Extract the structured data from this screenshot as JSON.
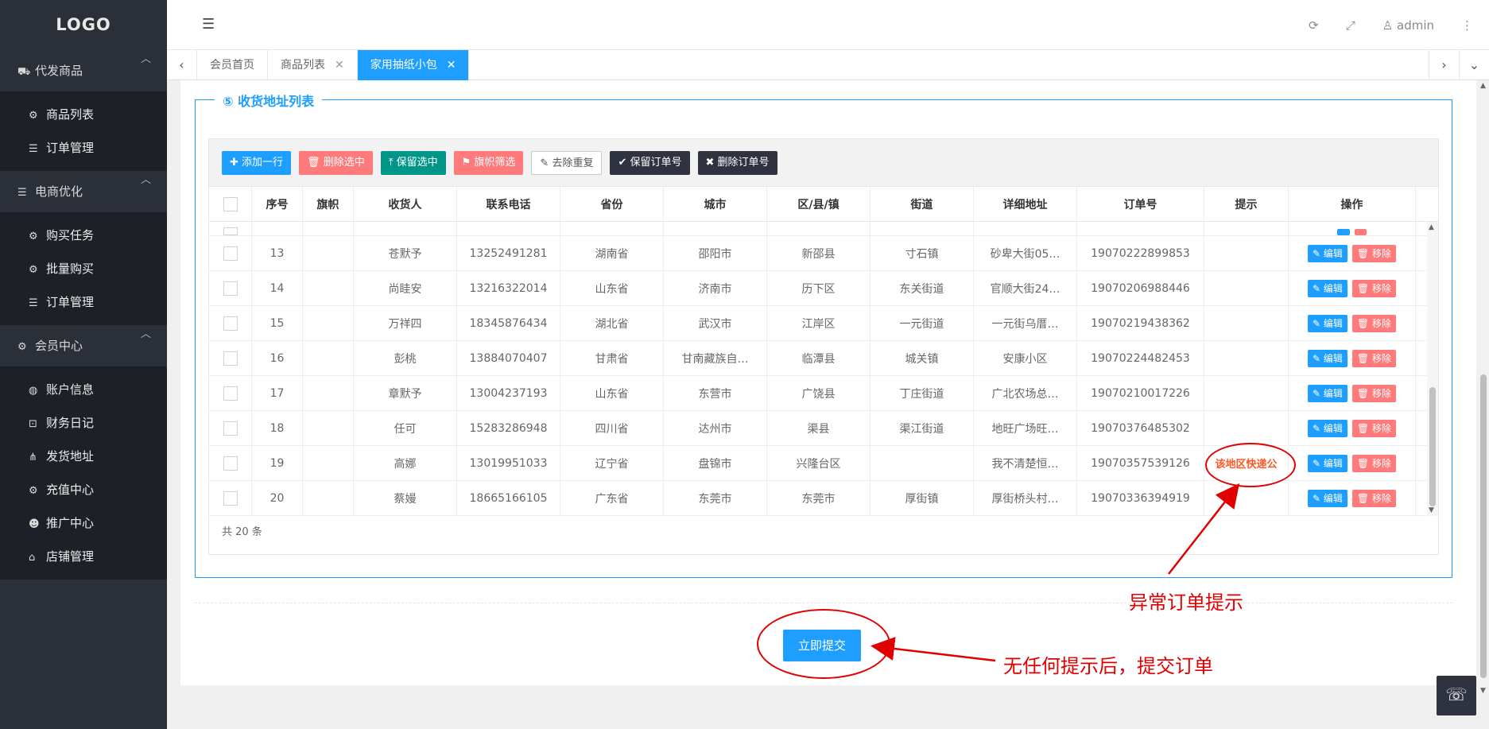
{
  "sidebar": {
    "logo": "LOGO",
    "groups": [
      {
        "label": "代发商品",
        "icon": "truck-icon",
        "items": [
          {
            "label": "商品列表",
            "icon": "gears-icon"
          },
          {
            "label": "订单管理",
            "icon": "list-icon"
          }
        ]
      },
      {
        "label": "电商优化",
        "icon": "list-icon",
        "items": [
          {
            "label": "购买任务",
            "icon": "gears-icon"
          },
          {
            "label": "批量购买",
            "icon": "gears-icon"
          },
          {
            "label": "订单管理",
            "icon": "list-icon"
          }
        ]
      },
      {
        "label": "会员中心",
        "icon": "gear-icon",
        "items": [
          {
            "label": "账户信息",
            "icon": "globe-icon"
          },
          {
            "label": "财务日记",
            "icon": "lock-icon"
          },
          {
            "label": "发货地址",
            "icon": "sitemap-icon"
          },
          {
            "label": "充值中心",
            "icon": "gears-icon"
          },
          {
            "label": "推广中心",
            "icon": "users-icon"
          },
          {
            "label": "店铺管理",
            "icon": "bank-icon"
          }
        ]
      }
    ]
  },
  "header": {
    "user": "admin"
  },
  "tabs": [
    {
      "label": "会员首页",
      "closable": false,
      "active": false
    },
    {
      "label": "商品列表",
      "closable": true,
      "active": false
    },
    {
      "label": "家用抽纸小包",
      "closable": true,
      "active": true
    }
  ],
  "panel": {
    "legend": "⑤ 收货地址列表",
    "toolbar": {
      "add": "添加一行",
      "delete_selected": "删除选中",
      "keep_selected": "保留选中",
      "flag_filter": "旗帜筛选",
      "dedupe": "去除重复",
      "keep_order": "保留订单号",
      "delete_order": "删除订单号"
    },
    "columns": [
      "序号",
      "旗帜",
      "收货人",
      "联系电话",
      "省份",
      "城市",
      "区/县/镇",
      "街道",
      "详细地址",
      "订单号",
      "提示",
      "操作"
    ],
    "rows": [
      {
        "seq": "13",
        "flag": "",
        "name": "苍默予",
        "phone": "13252491281",
        "province": "湖南省",
        "city": "邵阳市",
        "district": "新邵县",
        "street": "寸石镇",
        "address": "砂卑大街05…",
        "order": "19070222899853",
        "hint": ""
      },
      {
        "seq": "14",
        "flag": "",
        "name": "尚眭安",
        "phone": "13216322014",
        "province": "山东省",
        "city": "济南市",
        "district": "历下区",
        "street": "东关街道",
        "address": "官顺大街24…",
        "order": "19070206988446",
        "hint": ""
      },
      {
        "seq": "15",
        "flag": "",
        "name": "万祥四",
        "phone": "18345876434",
        "province": "湖北省",
        "city": "武汉市",
        "district": "江岸区",
        "street": "一元街道",
        "address": "一元街乌厝…",
        "order": "19070219438362",
        "hint": ""
      },
      {
        "seq": "16",
        "flag": "",
        "name": "彭桃",
        "phone": "13884070407",
        "province": "甘肃省",
        "city": "甘南藏族自…",
        "district": "临潭县",
        "street": "城关镇",
        "address": "安康小区",
        "order": "19070224482453",
        "hint": ""
      },
      {
        "seq": "17",
        "flag": "",
        "name": "章默予",
        "phone": "13004237193",
        "province": "山东省",
        "city": "东营市",
        "district": "广饶县",
        "street": "丁庄街道",
        "address": "广北农场总…",
        "order": "19070210017226",
        "hint": ""
      },
      {
        "seq": "18",
        "flag": "",
        "name": "任可",
        "phone": "15283286948",
        "province": "四川省",
        "city": "达州市",
        "district": "渠县",
        "street": "渠江街道",
        "address": "地旺广场旺…",
        "order": "19070376485302",
        "hint": ""
      },
      {
        "seq": "19",
        "flag": "",
        "name": "高娜",
        "phone": "13019951033",
        "province": "辽宁省",
        "city": "盘锦市",
        "district": "兴隆台区",
        "street": "",
        "address": "我不清楚恒…",
        "order": "19070357539126",
        "hint": "该地区快递公"
      },
      {
        "seq": "20",
        "flag": "",
        "name": "蔡嫚",
        "phone": "18665166105",
        "province": "广东省",
        "city": "东莞市",
        "district": "东莞市",
        "street": "厚街镇",
        "address": "厚街桥头村…",
        "order": "19070336394919",
        "hint": ""
      }
    ],
    "edit_label": "编辑",
    "remove_label": "移除",
    "total": "共 20 条"
  },
  "submit": "立即提交",
  "annotations": {
    "abnormal": "异常订单提示",
    "submit_hint": "无任何提示后，提交订单"
  },
  "colors": {
    "accent": "#1e9fff",
    "danger": "#ff7a7a",
    "success": "#009688",
    "annotation": "#e00000"
  }
}
